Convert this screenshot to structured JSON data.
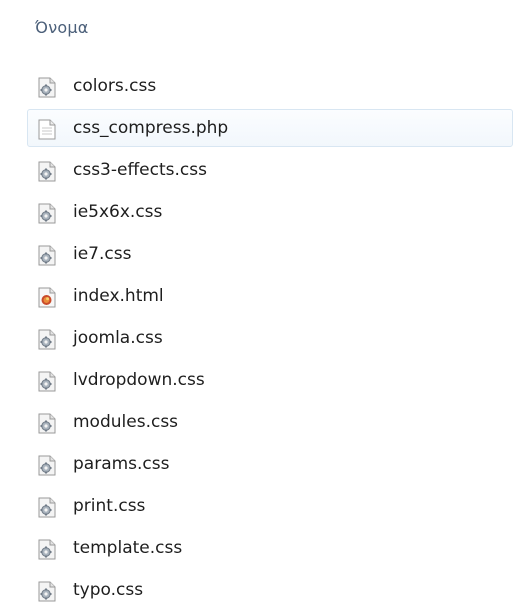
{
  "header": {
    "name_column": "Όνομα"
  },
  "files": [
    {
      "name": "colors.css",
      "icon": "css-file-icon",
      "selected": false
    },
    {
      "name": "css_compress.php",
      "icon": "text-file-icon",
      "selected": true
    },
    {
      "name": "css3-effects.css",
      "icon": "css-file-icon",
      "selected": false
    },
    {
      "name": "ie5x6x.css",
      "icon": "css-file-icon",
      "selected": false
    },
    {
      "name": "ie7.css",
      "icon": "css-file-icon",
      "selected": false
    },
    {
      "name": "index.html",
      "icon": "html-file-icon",
      "selected": false
    },
    {
      "name": "joomla.css",
      "icon": "css-file-icon",
      "selected": false
    },
    {
      "name": "lvdropdown.css",
      "icon": "css-file-icon",
      "selected": false
    },
    {
      "name": "modules.css",
      "icon": "css-file-icon",
      "selected": false
    },
    {
      "name": "params.css",
      "icon": "css-file-icon",
      "selected": false
    },
    {
      "name": "print.css",
      "icon": "css-file-icon",
      "selected": false
    },
    {
      "name": "template.css",
      "icon": "css-file-icon",
      "selected": false
    },
    {
      "name": "typo.css",
      "icon": "css-file-icon",
      "selected": false
    }
  ],
  "colors": {
    "header_text": "#4c607a",
    "selection_border": "#d8e6f2",
    "file_text": "#1e1e1e"
  }
}
